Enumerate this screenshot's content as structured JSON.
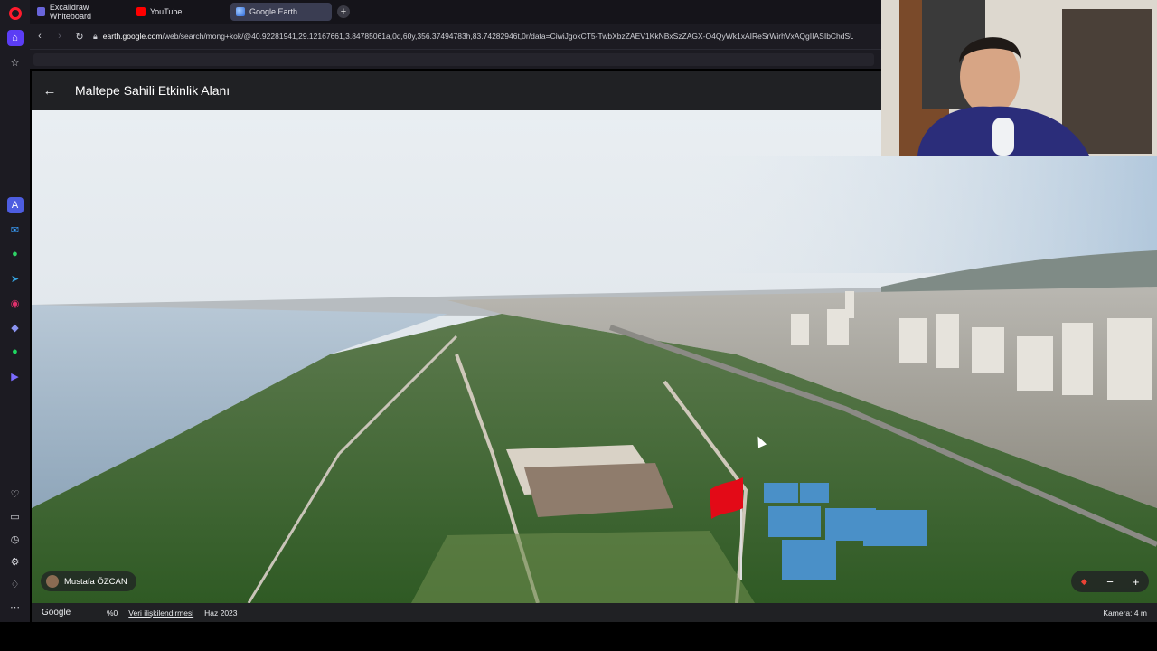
{
  "browser": {
    "tabs": [
      {
        "label": "Excalidraw Whiteboard",
        "icon": "excalidraw-icon"
      },
      {
        "label": "YouTube",
        "icon": "youtube-icon"
      },
      {
        "label": "Google Earth",
        "icon": "google-earth-icon",
        "active": true
      }
    ],
    "url_host": "earth.google.com",
    "url_path": "/web/search/mong+kok/@40.92281941,29.12167661,3.84785061a,0d,60y,356.37494783h,83.74282946t,0r/data=CiwiJgokCT5-TwbXbzZAEV1KkNBxSzZAGX-O4QyWk1xAIReSrWirhVxAQgIIASIbChdSUhNM"
  },
  "sidebar": {
    "icons": [
      "opera-icon",
      "home-icon",
      "star-icon",
      "aria-icon",
      "messenger-icon",
      "whatsapp-icon",
      "telegram-icon",
      "instagram-icon",
      "discord-icon",
      "spotify-icon",
      "player-icon",
      "heart-icon",
      "message-icon",
      "history-icon",
      "settings-icon",
      "lightbulb-icon",
      "more-icon"
    ]
  },
  "earth": {
    "title": "Maltepe Sahili Etkinlik Alanı",
    "author": "Mustafa ÖZCAN",
    "zoom_minus": "−",
    "zoom_plus": "+"
  },
  "footer": {
    "logo": "Google",
    "scale": "%0",
    "data_attribution": "Veri ilişkilendirmesi",
    "date": "Haz 2023",
    "camera": "Kamera: 4 m"
  },
  "colors": {
    "sidebar_bg": "#1c1b22",
    "active_tab": "#3a3d52",
    "earth_header": "#202124",
    "opera_red": "#ff1b2d"
  }
}
